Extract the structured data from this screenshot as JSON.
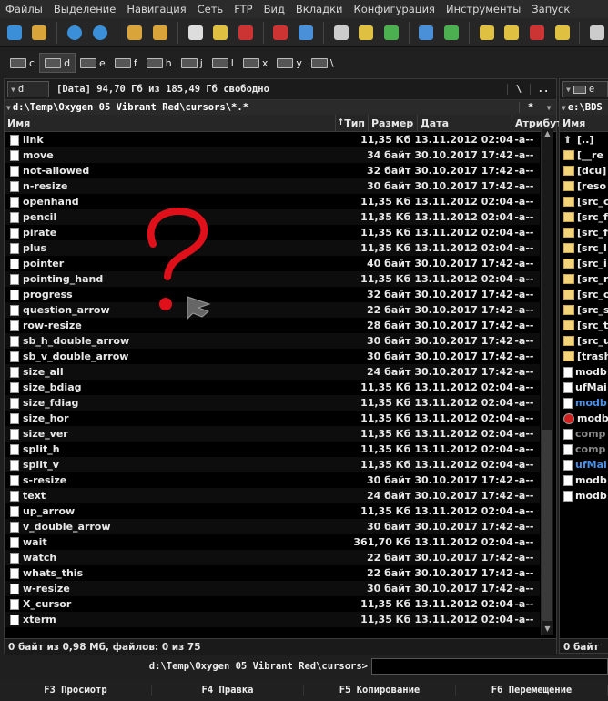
{
  "menu": [
    "Файлы",
    "Выделение",
    "Навигация",
    "Сеть",
    "FTP",
    "Вид",
    "Вкладки",
    "Конфигурация",
    "Инструменты",
    "Запуск"
  ],
  "toolbar_icons": [
    "refresh-icon",
    "view-settings-icon",
    "back-icon",
    "forward-icon",
    "pack-icon",
    "unpack-icon",
    "select-icon",
    "edit-icon",
    "multi-rename-icon",
    "ftp-icon",
    "url-icon",
    "search-icon",
    "sync-icon",
    "copy-names-icon",
    "view-icon",
    "open-icon",
    "layout-icon",
    "brief-view-icon",
    "tree-icon",
    "panel-icon",
    "more-icon"
  ],
  "drives": [
    {
      "letter": "c",
      "active": false
    },
    {
      "letter": "d",
      "active": true
    },
    {
      "letter": "e",
      "active": false
    },
    {
      "letter": "f",
      "active": false
    },
    {
      "letter": "h",
      "active": false
    },
    {
      "letter": "j",
      "active": false
    },
    {
      "letter": "l",
      "active": false
    },
    {
      "letter": "x",
      "active": false
    },
    {
      "letter": "y",
      "active": false
    },
    {
      "letter": "\\",
      "active": false
    }
  ],
  "left_panel": {
    "drive_combo": "d",
    "drive_info": "[Data]  94,70 Гб из 185,49 Гб свободно",
    "root_btn": "\\",
    "up_btn": "..",
    "path": "d:\\Temp\\Oxygen 05 Vibrant Red\\cursors\\*.*",
    "filter": "*",
    "columns": {
      "name": "Имя",
      "type": "Тип",
      "size": "Размер",
      "date": "Дата",
      "attr": "Атрибут"
    },
    "files": [
      {
        "name": "link",
        "size": "11,35 Кб",
        "date": "13.11.2012 02:04",
        "attr": "-a--"
      },
      {
        "name": "move",
        "size": "34 байт",
        "date": "30.10.2017 17:42",
        "attr": "-a--"
      },
      {
        "name": "not-allowed",
        "size": "32 байт",
        "date": "30.10.2017 17:42",
        "attr": "-a--"
      },
      {
        "name": "n-resize",
        "size": "30 байт",
        "date": "30.10.2017 17:42",
        "attr": "-a--"
      },
      {
        "name": "openhand",
        "size": "11,35 Кб",
        "date": "13.11.2012 02:04",
        "attr": "-a--"
      },
      {
        "name": "pencil",
        "size": "11,35 Кб",
        "date": "13.11.2012 02:04",
        "attr": "-a--"
      },
      {
        "name": "pirate",
        "size": "11,35 Кб",
        "date": "13.11.2012 02:04",
        "attr": "-a--"
      },
      {
        "name": "plus",
        "size": "11,35 Кб",
        "date": "13.11.2012 02:04",
        "attr": "-a--"
      },
      {
        "name": "pointer",
        "size": "40 байт",
        "date": "30.10.2017 17:42",
        "attr": "-a--"
      },
      {
        "name": "pointing_hand",
        "size": "11,35 Кб",
        "date": "13.11.2012 02:04",
        "attr": "-a--"
      },
      {
        "name": "progress",
        "size": "32 байт",
        "date": "30.10.2017 17:42",
        "attr": "-a--"
      },
      {
        "name": "question_arrow",
        "size": "22 байт",
        "date": "30.10.2017 17:42",
        "attr": "-a--"
      },
      {
        "name": "row-resize",
        "size": "28 байт",
        "date": "30.10.2017 17:42",
        "attr": "-a--"
      },
      {
        "name": "sb_h_double_arrow",
        "size": "30 байт",
        "date": "30.10.2017 17:42",
        "attr": "-a--"
      },
      {
        "name": "sb_v_double_arrow",
        "size": "30 байт",
        "date": "30.10.2017 17:42",
        "attr": "-a--"
      },
      {
        "name": "size_all",
        "size": "24 байт",
        "date": "30.10.2017 17:42",
        "attr": "-a--"
      },
      {
        "name": "size_bdiag",
        "size": "11,35 Кб",
        "date": "13.11.2012 02:04",
        "attr": "-a--"
      },
      {
        "name": "size_fdiag",
        "size": "11,35 Кб",
        "date": "13.11.2012 02:04",
        "attr": "-a--"
      },
      {
        "name": "size_hor",
        "size": "11,35 Кб",
        "date": "13.11.2012 02:04",
        "attr": "-a--"
      },
      {
        "name": "size_ver",
        "size": "11,35 Кб",
        "date": "13.11.2012 02:04",
        "attr": "-a--"
      },
      {
        "name": "split_h",
        "size": "11,35 Кб",
        "date": "13.11.2012 02:04",
        "attr": "-a--"
      },
      {
        "name": "split_v",
        "size": "11,35 Кб",
        "date": "13.11.2012 02:04",
        "attr": "-a--"
      },
      {
        "name": "s-resize",
        "size": "30 байт",
        "date": "30.10.2017 17:42",
        "attr": "-a--"
      },
      {
        "name": "text",
        "size": "24 байт",
        "date": "30.10.2017 17:42",
        "attr": "-a--"
      },
      {
        "name": "up_arrow",
        "size": "11,35 Кб",
        "date": "13.11.2012 02:04",
        "attr": "-a--"
      },
      {
        "name": "v_double_arrow",
        "size": "30 байт",
        "date": "30.10.2017 17:42",
        "attr": "-a--"
      },
      {
        "name": "wait",
        "size": "361,70 Кб",
        "date": "13.11.2012 02:04",
        "attr": "-a--"
      },
      {
        "name": "watch",
        "size": "22 байт",
        "date": "30.10.2017 17:42",
        "attr": "-a--"
      },
      {
        "name": "whats_this",
        "size": "22 байт",
        "date": "30.10.2017 17:42",
        "attr": "-a--"
      },
      {
        "name": "w-resize",
        "size": "30 байт",
        "date": "30.10.2017 17:42",
        "attr": "-a--"
      },
      {
        "name": "X_cursor",
        "size": "11,35 Кб",
        "date": "13.11.2012 02:04",
        "attr": "-a--"
      },
      {
        "name": "xterm",
        "size": "11,35 Кб",
        "date": "13.11.2012 02:04",
        "attr": "-a--"
      }
    ],
    "status": "0 байт из 0,98 Мб, файлов: 0 из 75"
  },
  "right_panel": {
    "drive_combo": "e",
    "path": "e:\\BDS",
    "col_name": "Имя",
    "items": [
      {
        "name": "[..]",
        "type": "up"
      },
      {
        "name": "[__re",
        "type": "folder"
      },
      {
        "name": "[dcu]",
        "type": "folder"
      },
      {
        "name": "[reso",
        "type": "folder"
      },
      {
        "name": "[src_c",
        "type": "folder"
      },
      {
        "name": "[src_f",
        "type": "folder"
      },
      {
        "name": "[src_f",
        "type": "folder"
      },
      {
        "name": "[src_l",
        "type": "folder"
      },
      {
        "name": "[src_i",
        "type": "folder"
      },
      {
        "name": "[src_r",
        "type": "folder"
      },
      {
        "name": "[src_o",
        "type": "folder"
      },
      {
        "name": "[src_s",
        "type": "folder"
      },
      {
        "name": "[src_t",
        "type": "folder"
      },
      {
        "name": "[src_u",
        "type": "folder"
      },
      {
        "name": "[trash",
        "type": "folder"
      },
      {
        "name": "modb",
        "type": "file"
      },
      {
        "name": "ufMai",
        "type": "file"
      },
      {
        "name": "modb",
        "type": "file-blue"
      },
      {
        "name": "modb",
        "type": "file-red"
      },
      {
        "name": "comp",
        "type": "file-grey"
      },
      {
        "name": "comp",
        "type": "file-grey"
      },
      {
        "name": "ufMai",
        "type": "file-blue"
      },
      {
        "name": "modb",
        "type": "file"
      },
      {
        "name": "modb",
        "type": "file"
      }
    ],
    "status": "0 байт"
  },
  "cmdline": {
    "path": "d:\\Temp\\Oxygen 05 Vibrant Red\\cursors>",
    "value": ""
  },
  "fkeys": [
    "F3 Просмотр",
    "F4 Правка",
    "F5 Копирование",
    "F6 Перемещение"
  ],
  "colors": {
    "question_mark": "#e0101a",
    "accent": "#3a7bd5"
  }
}
